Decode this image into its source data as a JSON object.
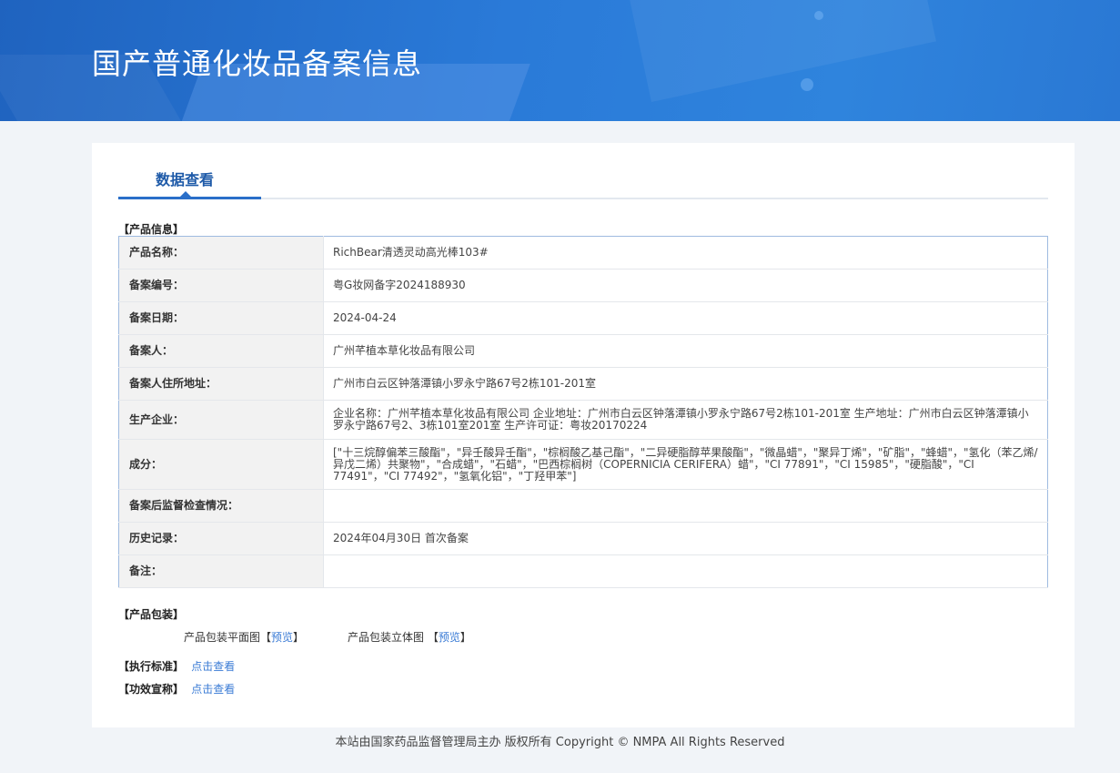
{
  "header": {
    "title": "国产普通化妆品备案信息"
  },
  "tab": {
    "label": "数据查看"
  },
  "sections": {
    "product_info": "【产品信息】",
    "packaging": "【产品包装】",
    "standard": "【执行标准】",
    "efficacy": "【功效宣称】"
  },
  "rows": [
    {
      "key": "产品名称：",
      "value": "RichBear清透灵动高光棒103#"
    },
    {
      "key": "备案编号：",
      "value": "粤G妆网备字2024188930"
    },
    {
      "key": "备案日期：",
      "value": "2024-04-24"
    },
    {
      "key": "备案人：",
      "value": "广州芊植本草化妆品有限公司"
    },
    {
      "key": "备案人住所地址：",
      "value": "广州市白云区钟落潭镇小罗永宁路67号2栋101-201室"
    },
    {
      "key": "生产企业：",
      "value": "企业名称：广州芊植本草化妆品有限公司 企业地址：广州市白云区钟落潭镇小罗永宁路67号2栋101-201室 生产地址：广州市白云区钟落潭镇小罗永宁路67号2、3栋101室201室 生产许可证：粤妆20170224"
    },
    {
      "key": "成分：",
      "value": "[\"十三烷醇偏苯三酸酯\"，\"异壬酸异壬酯\"，\"棕榈酸乙基己酯\"，\"二异硬脂醇苹果酸酯\"，\"微晶蜡\"，\"聚异丁烯\"，\"矿脂\"，\"蜂蜡\"，\"氢化（苯乙烯/异戊二烯）共聚物\"，\"合成蜡\"，\"石蜡\"，\"巴西棕榈树（COPERNICIA CERIFERA）蜡\"，\"CI 77891\"，\"CI 15985\"，\"硬脂酸\"，\"CI 77491\"，\"CI 77492\"，\"氢氧化铝\"，\"丁羟甲苯\"]"
    },
    {
      "key": "备案后监督检查情况：",
      "value": ""
    },
    {
      "key": "历史记录：",
      "value": "2024年04月30日 首次备案"
    },
    {
      "key": "备注：",
      "value": ""
    }
  ],
  "packaging": {
    "flat_label": "产品包装平面图",
    "stereo_label": "产品包装立体图",
    "bracket_open": "【",
    "bracket_close": "】",
    "preview": "预览"
  },
  "links": {
    "view": "点击查看"
  },
  "footer": {
    "text": "本站由国家药品监督管理局主办 版权所有 Copyright © NMPA All Rights Reserved"
  }
}
